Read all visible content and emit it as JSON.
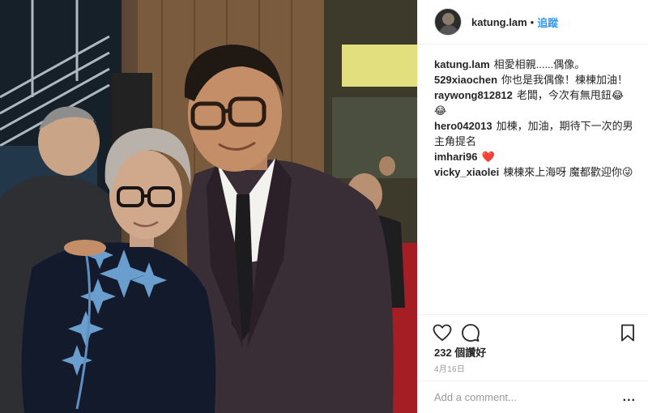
{
  "post": {
    "username": "katung.lam",
    "separator": "•",
    "follow_label": "追蹤",
    "likes": "232 個讚好",
    "date": "4月16日",
    "comment_placeholder": "Add a comment...",
    "more_label": "..."
  },
  "comments": [
    {
      "user": "katung.lam",
      "text": "相愛相親......偶像。"
    },
    {
      "user": "529xiaochen",
      "text": "你也是我偶像！棟棟加油！"
    },
    {
      "user": "raywong812812",
      "text": "老闆，今次有無甩鈕😂 😂"
    },
    {
      "user": "hero042013",
      "text": "加棟，加油，期待下一次的男主角提名"
    },
    {
      "user": "imhari96",
      "text": "❤️"
    },
    {
      "user": "vicky_xiaolei",
      "text": "棟棟來上海呀 魔都歡迎你😜"
    }
  ],
  "icons": {
    "like": "heart-icon",
    "comment": "comment-bubble-icon",
    "save": "bookmark-icon",
    "avatar": "avatar"
  },
  "colors": {
    "link_blue": "#3897f0",
    "heart_red": "#ed4956"
  }
}
